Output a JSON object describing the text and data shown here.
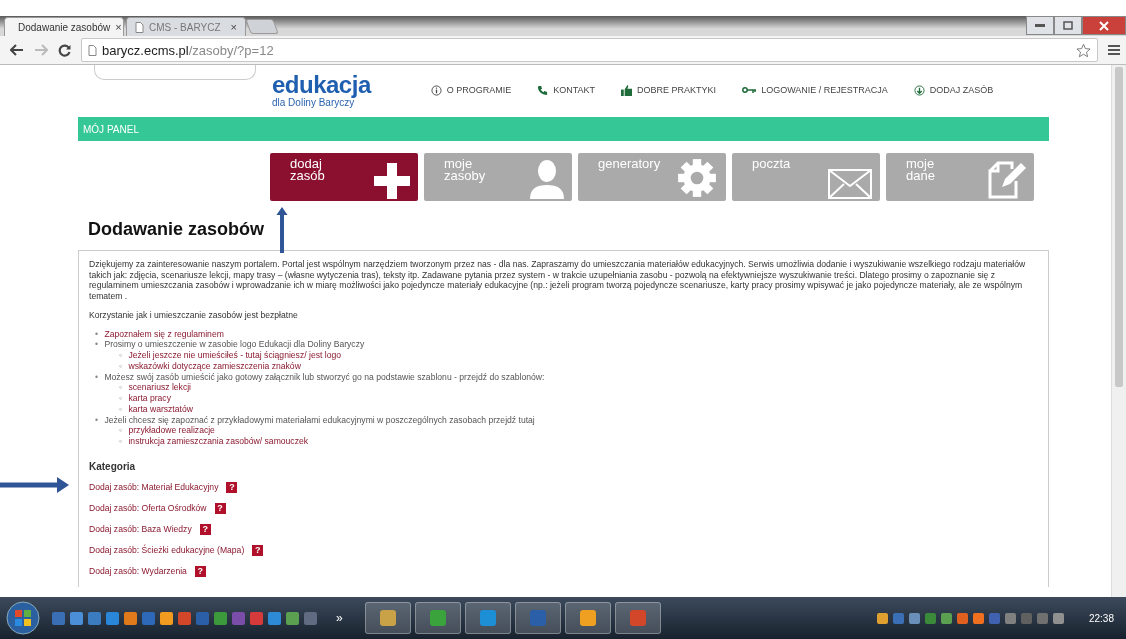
{
  "browser": {
    "tabs": [
      {
        "title": "Dodawanie zasobów",
        "close": "×",
        "selected": true
      },
      {
        "title": "CMS - BARYCZ",
        "close": "×",
        "selected": false
      }
    ],
    "url": {
      "host": "barycz.ecms.pl",
      "path": "/zasoby/?p=12"
    }
  },
  "site": {
    "logo": {
      "title": "edukacja",
      "subtitle": "dla Doliny Baryczy"
    },
    "nav": [
      {
        "label": "O PROGRAMIE",
        "kind": "info"
      },
      {
        "label": "KONTAKT",
        "kind": "phone"
      },
      {
        "label": "DOBRE PRAKTYKI",
        "kind": "thumb"
      },
      {
        "label": "LOGOWANIE / REJESTRACJA",
        "kind": "key"
      },
      {
        "label": "DODAJ ZASÓB",
        "kind": "add"
      }
    ],
    "panel_title": "MÓJ PANEL",
    "tiles": [
      {
        "label": "dodaj\nzasób",
        "kind": "plus",
        "selected": true
      },
      {
        "label": "moje\nzasoby",
        "kind": "person",
        "selected": false
      },
      {
        "label": "generatory",
        "kind": "gear",
        "selected": false
      },
      {
        "label": "poczta",
        "kind": "mail",
        "selected": false
      },
      {
        "label": "moje\ndane",
        "kind": "edit",
        "selected": false
      }
    ]
  },
  "page": {
    "heading": "Dodawanie zasobów",
    "intro": "Dziękujemy za zainteresowanie naszym portalem. Portal jest wspólnym narzędziem tworzonym przez nas - dla nas. Zapraszamy do umieszczania  materiałów edukacyjnych. Serwis umożliwia dodanie i wyszukiwanie wszelkiego rodzaju materiałów takich jak: zdjęcia, scenariusze lekcji, mapy trasy – (własne wytyczenia tras), teksty itp. Zadawane pytania przez system -  w trakcie uzupełniania zasobu - pozwolą na efektywniejsze wyszukiwanie treści.  Dlatego prosimy o zapoznanie się z regulaminem umieszczania zasobów i wprowadzanie ich w miarę możliwości jako pojedyncze materiały edukacyjne (np.: jeżeli program tworzą pojedyncze scenariusze, karty pracy prosimy wpisywać je jako pojedyncze materiały, ale ze wspólnym tematem .",
    "note": "Korzystanie jak i umieszczanie zasobów jest bezpłatne",
    "list": [
      {
        "bullet": "•",
        "text": "Zapoznałem się z regulaminem",
        "kind": "link"
      },
      {
        "bullet": "•",
        "text": "Prosimy o umieszczenie  w zasobie logo Edukacji dla Doliny Baryczy",
        "kind": "text",
        "children": [
          {
            "bullet": "◦",
            "text": "Jeżeli jeszcze nie umieściłeś - tutaj ściągniesz/ jest logo",
            "kind": "link"
          },
          {
            "bullet": "◦",
            "text": "wskazówki dotyczące zamieszczenia znaków",
            "kind": "link"
          }
        ]
      },
      {
        "bullet": "•",
        "text": "Możesz swój zasób umieścić jako gotowy załącznik lub stworzyć go na podstawie szablonu - przejdź do szablonów:",
        "kind": "text",
        "children": [
          {
            "bullet": "◦",
            "text": "scenariusz lekcji",
            "kind": "link"
          },
          {
            "bullet": "◦",
            "text": "karta pracy",
            "kind": "link"
          },
          {
            "bullet": "◦",
            "text": "karta warsztatów",
            "kind": "link"
          }
        ]
      },
      {
        "bullet": "•",
        "text": "Jeżeli chcesz się zapoznać z przykładowymi materiałami edukacyjnymi w poszczególnych zasobach przejdź tutaj",
        "kind": "text",
        "children": [
          {
            "bullet": "◦",
            "text": "przykładowe realizacje",
            "kind": "link"
          },
          {
            "bullet": "◦",
            "text": "instrukcja zamieszczania zasobów/ samouczek",
            "kind": "link"
          }
        ]
      }
    ],
    "category_heading": "Kategoria",
    "categories": [
      {
        "label": "Dodaj zasób: Materiał Edukacyjny",
        "help": "?"
      },
      {
        "label": "Dodaj zasób: Oferta Ośrodków",
        "help": "?"
      },
      {
        "label": "Dodaj zasób: Baza Wiedzy",
        "help": "?"
      },
      {
        "label": "Dodaj zasób: Ścieżki edukacyjne (Mapa)",
        "help": "?"
      },
      {
        "label": "Dodaj zasób: Wydarzenia",
        "help": "?"
      }
    ]
  },
  "taskbar": {
    "overflow": "»",
    "clock": "22:38"
  }
}
